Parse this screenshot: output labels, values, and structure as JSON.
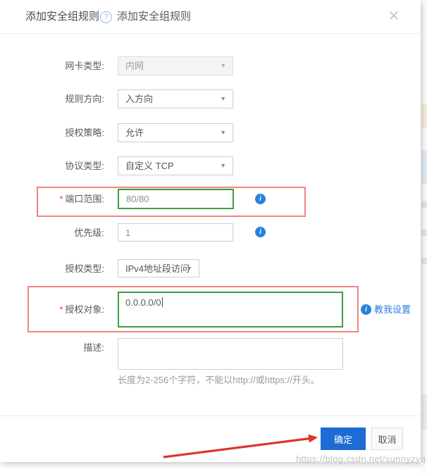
{
  "header": {
    "title": "添加安全组规则",
    "subtitle": "添加安全组规则"
  },
  "icons": {
    "help": "?",
    "close": "×",
    "chevron_down": "▼",
    "info": "i"
  },
  "form": {
    "nic_type": {
      "label": "网卡类型:",
      "value": "内网",
      "disabled": true
    },
    "direction": {
      "label": "规则方向:",
      "value": "入方向"
    },
    "policy": {
      "label": "授权策略:",
      "value": "允许"
    },
    "protocol": {
      "label": "协议类型:",
      "value": "自定义 TCP"
    },
    "port_range": {
      "required_mark": "*",
      "label": "端口范围:",
      "value": "80/80"
    },
    "priority": {
      "label": "优先级:",
      "value": "1"
    },
    "auth_type": {
      "label": "授权类型:",
      "value": "IPv4地址段访问"
    },
    "auth_object": {
      "required_mark": "*",
      "label": "授权对象:",
      "value": "0.0.0.0/0",
      "help_link": "教我设置"
    },
    "description": {
      "label": "描述:",
      "value": "",
      "hint": "长度为2-256个字符，不能以http://或https://开头。"
    }
  },
  "footer": {
    "confirm_label": "确定",
    "cancel_label": "取消"
  },
  "watermark": "https://blog.csdn.net/sunnyzyq",
  "colors": {
    "primary_blue": "#1c6cd3",
    "link_blue": "#2d7cd8",
    "info_blue": "#2384d8",
    "valid_green": "#3f9d3f",
    "highlight_red": "#ee8585",
    "annotation_red": "#e0332c"
  }
}
